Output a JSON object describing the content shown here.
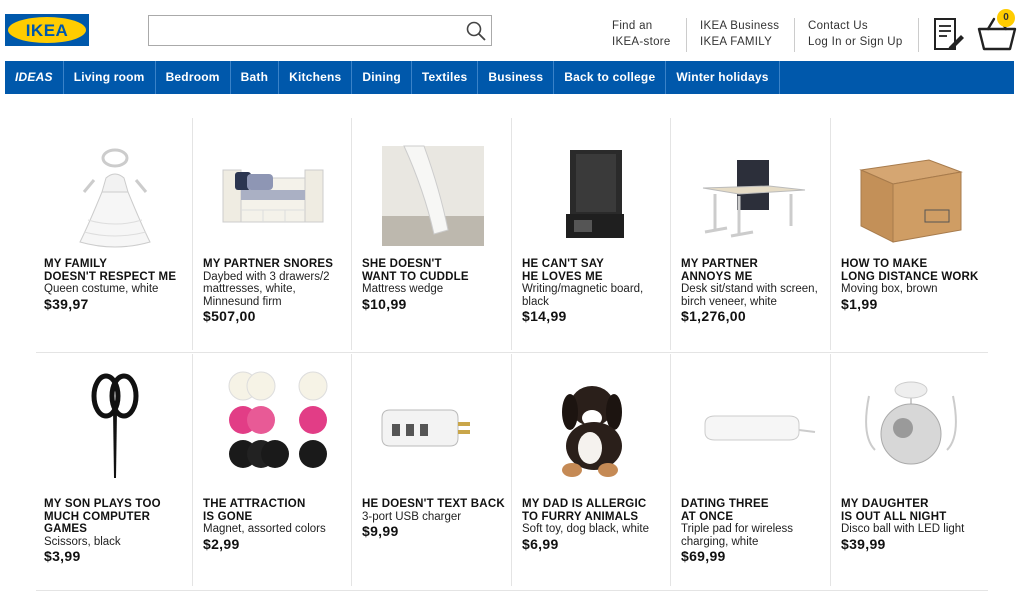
{
  "header": {
    "logo_text": "IKEA",
    "search": {
      "value": "",
      "placeholder": ""
    },
    "links": [
      {
        "line1": "Find an",
        "line2": "IKEA-store"
      },
      {
        "line1": "IKEA Business",
        "line2": "IKEA FAMILY"
      },
      {
        "line1": "Contact Us",
        "line2": "Log In or Sign Up"
      }
    ],
    "basket_count": "0"
  },
  "nav": {
    "items": [
      "IDEAS",
      "Living room",
      "Bedroom",
      "Bath",
      "Kitchens",
      "Dining",
      "Textiles",
      "Business",
      "Back to college",
      "Winter holidays"
    ]
  },
  "products": [
    {
      "title": "MY FAMILY\nDOESN'T RESPECT ME",
      "desc": "Queen costume, white",
      "price": "$39,97",
      "icon": "queen-costume-icon"
    },
    {
      "title": "MY PARTNER SNORES",
      "desc": "Daybed with 3 drawers/2\nmattresses, white,\nMinnesund firm",
      "price": "$507,00",
      "icon": "daybed-icon"
    },
    {
      "title": "SHE DOESN'T\nWANT TO CUDDLE",
      "desc": "Mattress wedge",
      "price": "$10,99",
      "icon": "mattress-wedge-icon"
    },
    {
      "title": "HE CAN'T SAY\nHE LOVES ME",
      "desc": "Writing/magnetic board,\nblack",
      "price": "$14,99",
      "icon": "magnetic-board-icon"
    },
    {
      "title": "MY PARTNER\nANNOYS ME",
      "desc": "Desk sit/stand with screen,\nbirch veneer, white",
      "price": "$1,276,00",
      "icon": "desk-icon"
    },
    {
      "title": "HOW TO MAKE\nLONG DISTANCE WORK",
      "desc": "Moving box, brown",
      "price": "$1,99",
      "icon": "moving-box-icon"
    },
    {
      "title": "MY SON PLAYS TOO\nMUCH COMPUTER\nGAMES",
      "desc": "Scissors, black",
      "price": "$3,99",
      "icon": "scissors-icon"
    },
    {
      "title": "THE ATTRACTION\nIS GONE",
      "desc": "Magnet, assorted colors",
      "price": "$2,99",
      "icon": "magnets-icon"
    },
    {
      "title": "HE DOESN'T TEXT BACK",
      "desc": "3-port USB charger",
      "price": "$9,99",
      "icon": "usb-charger-icon"
    },
    {
      "title": "MY DAD IS ALLERGIC\nTO FURRY ANIMALS",
      "desc": "Soft toy, dog black, white",
      "price": "$6,99",
      "icon": "soft-toy-dog-icon"
    },
    {
      "title": "DATING THREE\nAT ONCE",
      "desc": "Triple pad for wireless\ncharging, white",
      "price": "$69,99",
      "icon": "wireless-pad-icon"
    },
    {
      "title": "MY DAUGHTER\nIS OUT ALL NIGHT",
      "desc": "Disco ball with LED light",
      "price": "$39,99",
      "icon": "disco-ball-icon"
    }
  ],
  "colors": {
    "brand_blue": "#0058ab",
    "brand_yellow": "#ffcc00"
  }
}
